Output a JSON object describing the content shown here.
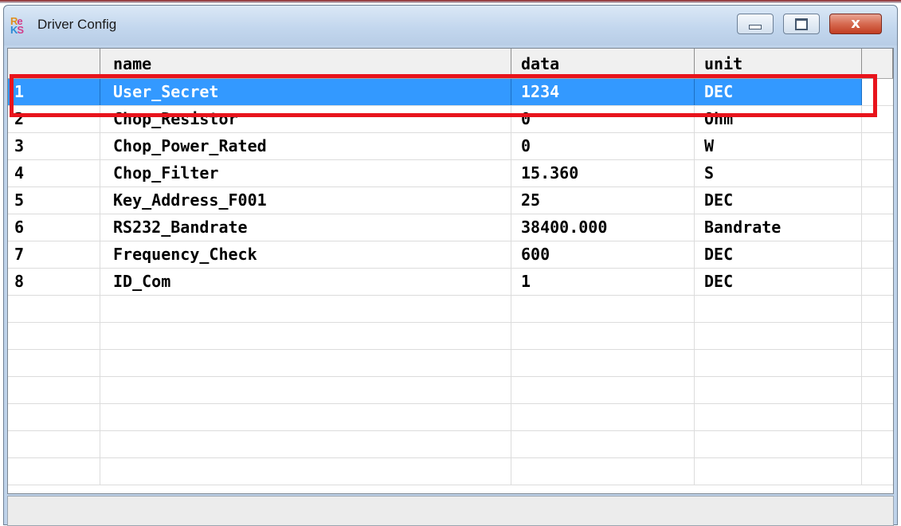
{
  "window": {
    "title": "Driver Config",
    "icon": "rks-app-icon",
    "controls": {
      "minimize": "minimize-icon",
      "maximize": "maximize-icon",
      "close_glyph": "x"
    }
  },
  "table": {
    "columns": [
      "",
      "name",
      "data",
      "unit"
    ],
    "rows": [
      {
        "index": "1",
        "name": "User_Secret",
        "data": "1234",
        "unit": "DEC"
      },
      {
        "index": "2",
        "name": "Chop_Resistor",
        "data": "0",
        "unit": "Ohm"
      },
      {
        "index": "3",
        "name": "Chop_Power_Rated",
        "data": "0",
        "unit": "W"
      },
      {
        "index": "4",
        "name": "Chop_Filter",
        "data": "15.360",
        "unit": "S"
      },
      {
        "index": "5",
        "name": "Key_Address_F001",
        "data": "25",
        "unit": "DEC"
      },
      {
        "index": "6",
        "name": "RS232_Bandrate",
        "data": "38400.000",
        "unit": "Bandrate"
      },
      {
        "index": "7",
        "name": "Frequency_Check",
        "data": "600",
        "unit": "DEC"
      },
      {
        "index": "8",
        "name": "ID_Com",
        "data": "1",
        "unit": "DEC"
      }
    ],
    "selected_row_index": "1",
    "empty_rows": 7
  },
  "colors": {
    "selection": "#3399ff",
    "highlight_outline": "#e8141c",
    "title_bar": "#c3d7ee"
  }
}
